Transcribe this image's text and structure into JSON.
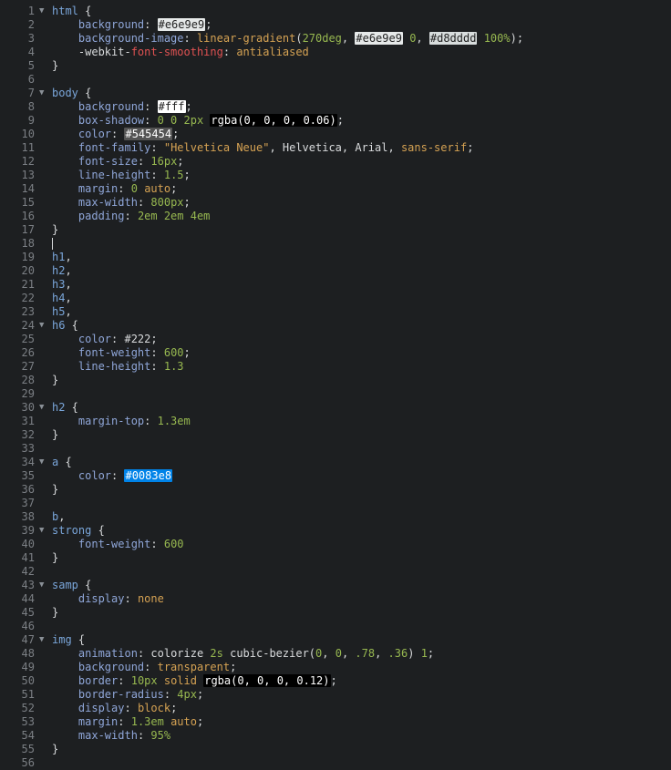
{
  "lines": [
    {
      "n": "1",
      "fold": true,
      "tokens": [
        {
          "t": "html",
          "c": "sel"
        },
        {
          "t": " {",
          "c": "p"
        }
      ]
    },
    {
      "n": "2",
      "fold": false,
      "tokens": [
        {
          "t": "    "
        },
        {
          "t": "background",
          "c": "prop"
        },
        {
          "t": ": ",
          "c": "p"
        },
        {
          "t": "#e6e9e9",
          "c": "hl",
          "bg": "#e6e9e9",
          "fg": "#222222"
        },
        {
          "t": ";",
          "c": "p"
        }
      ]
    },
    {
      "n": "3",
      "fold": false,
      "tokens": [
        {
          "t": "    "
        },
        {
          "t": "background-image",
          "c": "prop"
        },
        {
          "t": ": ",
          "c": "p"
        },
        {
          "t": "linear-gradient",
          "c": "kw"
        },
        {
          "t": "(",
          "c": "p"
        },
        {
          "t": "270deg",
          "c": "num"
        },
        {
          "t": ", ",
          "c": "p"
        },
        {
          "t": "#e6e9e9",
          "c": "hl",
          "bg": "#e6e9e9",
          "fg": "#222222"
        },
        {
          "t": " ",
          "c": "p"
        },
        {
          "t": "0",
          "c": "num"
        },
        {
          "t": ", ",
          "c": "p"
        },
        {
          "t": "#d8dddd",
          "c": "hl",
          "bg": "#d8dddd",
          "fg": "#222222"
        },
        {
          "t": " ",
          "c": "p"
        },
        {
          "t": "100%",
          "c": "num"
        },
        {
          "t": ");",
          "c": "p"
        }
      ]
    },
    {
      "n": "4",
      "fold": false,
      "tokens": [
        {
          "t": "    "
        },
        {
          "t": "-webkit-",
          "c": "p"
        },
        {
          "t": "font-smoothing",
          "c": "vendor"
        },
        {
          "t": ": ",
          "c": "p"
        },
        {
          "t": "antialiased",
          "c": "kw"
        }
      ]
    },
    {
      "n": "5",
      "fold": false,
      "tokens": [
        {
          "t": "}",
          "c": "p"
        }
      ]
    },
    {
      "n": "6",
      "fold": false,
      "tokens": []
    },
    {
      "n": "7",
      "fold": true,
      "tokens": [
        {
          "t": "body",
          "c": "sel"
        },
        {
          "t": " {",
          "c": "p"
        }
      ]
    },
    {
      "n": "8",
      "fold": false,
      "tokens": [
        {
          "t": "    "
        },
        {
          "t": "background",
          "c": "prop"
        },
        {
          "t": ": ",
          "c": "p"
        },
        {
          "t": "#fff",
          "c": "hl",
          "bg": "#ffffff",
          "fg": "#222222"
        },
        {
          "t": ";",
          "c": "p"
        }
      ]
    },
    {
      "n": "9",
      "fold": false,
      "tokens": [
        {
          "t": "    "
        },
        {
          "t": "box-shadow",
          "c": "prop"
        },
        {
          "t": ": ",
          "c": "p"
        },
        {
          "t": "0 0 2px",
          "c": "num"
        },
        {
          "t": " ",
          "c": "p"
        },
        {
          "t": "rgba(0, 0, 0, 0.06)",
          "c": "hl",
          "bg": "#000000",
          "fg": "#ffffff"
        },
        {
          "t": ";",
          "c": "p"
        }
      ]
    },
    {
      "n": "10",
      "fold": false,
      "tokens": [
        {
          "t": "    "
        },
        {
          "t": "color",
          "c": "prop"
        },
        {
          "t": ": ",
          "c": "p"
        },
        {
          "t": "#545454",
          "c": "hl",
          "bg": "#545454",
          "fg": "#ffffff"
        },
        {
          "t": ";",
          "c": "p"
        }
      ]
    },
    {
      "n": "11",
      "fold": false,
      "tokens": [
        {
          "t": "    "
        },
        {
          "t": "font-family",
          "c": "prop"
        },
        {
          "t": ": ",
          "c": "p"
        },
        {
          "t": "\"Helvetica Neue\"",
          "c": "str"
        },
        {
          "t": ", Helvetica, Arial, ",
          "c": "p"
        },
        {
          "t": "sans-serif",
          "c": "kw"
        },
        {
          "t": ";",
          "c": "p"
        }
      ]
    },
    {
      "n": "12",
      "fold": false,
      "tokens": [
        {
          "t": "    "
        },
        {
          "t": "font-size",
          "c": "prop"
        },
        {
          "t": ": ",
          "c": "p"
        },
        {
          "t": "16px",
          "c": "num"
        },
        {
          "t": ";",
          "c": "p"
        }
      ]
    },
    {
      "n": "13",
      "fold": false,
      "tokens": [
        {
          "t": "    "
        },
        {
          "t": "line-height",
          "c": "prop"
        },
        {
          "t": ": ",
          "c": "p"
        },
        {
          "t": "1.5",
          "c": "num"
        },
        {
          "t": ";",
          "c": "p"
        }
      ]
    },
    {
      "n": "14",
      "fold": false,
      "tokens": [
        {
          "t": "    "
        },
        {
          "t": "margin",
          "c": "prop"
        },
        {
          "t": ": ",
          "c": "p"
        },
        {
          "t": "0",
          "c": "num"
        },
        {
          "t": " ",
          "c": "p"
        },
        {
          "t": "auto",
          "c": "kw"
        },
        {
          "t": ";",
          "c": "p"
        }
      ]
    },
    {
      "n": "15",
      "fold": false,
      "tokens": [
        {
          "t": "    "
        },
        {
          "t": "max-width",
          "c": "prop"
        },
        {
          "t": ": ",
          "c": "p"
        },
        {
          "t": "800px",
          "c": "num"
        },
        {
          "t": ";",
          "c": "p"
        }
      ]
    },
    {
      "n": "16",
      "fold": false,
      "tokens": [
        {
          "t": "    "
        },
        {
          "t": "padding",
          "c": "prop"
        },
        {
          "t": ": ",
          "c": "p"
        },
        {
          "t": "2em 2em 4em",
          "c": "num"
        }
      ]
    },
    {
      "n": "17",
      "fold": false,
      "tokens": [
        {
          "t": "}",
          "c": "p"
        }
      ]
    },
    {
      "n": "18",
      "fold": false,
      "caret": true,
      "tokens": []
    },
    {
      "n": "19",
      "fold": false,
      "tokens": [
        {
          "t": "h1",
          "c": "sel"
        },
        {
          "t": ",",
          "c": "p"
        }
      ]
    },
    {
      "n": "20",
      "fold": false,
      "tokens": [
        {
          "t": "h2",
          "c": "sel"
        },
        {
          "t": ",",
          "c": "p"
        }
      ]
    },
    {
      "n": "21",
      "fold": false,
      "tokens": [
        {
          "t": "h3",
          "c": "sel"
        },
        {
          "t": ",",
          "c": "p"
        }
      ]
    },
    {
      "n": "22",
      "fold": false,
      "tokens": [
        {
          "t": "h4",
          "c": "sel"
        },
        {
          "t": ",",
          "c": "p"
        }
      ]
    },
    {
      "n": "23",
      "fold": false,
      "tokens": [
        {
          "t": "h5",
          "c": "sel"
        },
        {
          "t": ",",
          "c": "p"
        }
      ]
    },
    {
      "n": "24",
      "fold": true,
      "tokens": [
        {
          "t": "h6",
          "c": "sel"
        },
        {
          "t": " {",
          "c": "p"
        }
      ]
    },
    {
      "n": "25",
      "fold": false,
      "tokens": [
        {
          "t": "    "
        },
        {
          "t": "color",
          "c": "prop"
        },
        {
          "t": ": ",
          "c": "p"
        },
        {
          "t": "#222",
          "c": "p"
        },
        {
          "t": ";",
          "c": "p"
        }
      ]
    },
    {
      "n": "26",
      "fold": false,
      "tokens": [
        {
          "t": "    "
        },
        {
          "t": "font-weight",
          "c": "prop"
        },
        {
          "t": ": ",
          "c": "p"
        },
        {
          "t": "600",
          "c": "num"
        },
        {
          "t": ";",
          "c": "p"
        }
      ]
    },
    {
      "n": "27",
      "fold": false,
      "tokens": [
        {
          "t": "    "
        },
        {
          "t": "line-height",
          "c": "prop"
        },
        {
          "t": ": ",
          "c": "p"
        },
        {
          "t": "1.3",
          "c": "num"
        }
      ]
    },
    {
      "n": "28",
      "fold": false,
      "tokens": [
        {
          "t": "}",
          "c": "p"
        }
      ]
    },
    {
      "n": "29",
      "fold": false,
      "tokens": []
    },
    {
      "n": "30",
      "fold": true,
      "tokens": [
        {
          "t": "h2",
          "c": "sel"
        },
        {
          "t": " {",
          "c": "p"
        }
      ]
    },
    {
      "n": "31",
      "fold": false,
      "tokens": [
        {
          "t": "    "
        },
        {
          "t": "margin-top",
          "c": "prop"
        },
        {
          "t": ": ",
          "c": "p"
        },
        {
          "t": "1.3em",
          "c": "num"
        }
      ]
    },
    {
      "n": "32",
      "fold": false,
      "tokens": [
        {
          "t": "}",
          "c": "p"
        }
      ]
    },
    {
      "n": "33",
      "fold": false,
      "tokens": []
    },
    {
      "n": "34",
      "fold": true,
      "tokens": [
        {
          "t": "a",
          "c": "sel"
        },
        {
          "t": " {",
          "c": "p"
        }
      ]
    },
    {
      "n": "35",
      "fold": false,
      "tokens": [
        {
          "t": "    "
        },
        {
          "t": "color",
          "c": "prop"
        },
        {
          "t": ": ",
          "c": "p"
        },
        {
          "t": "#0083e8",
          "c": "hl",
          "bg": "#0083e8",
          "fg": "#ffffff"
        }
      ]
    },
    {
      "n": "36",
      "fold": false,
      "tokens": [
        {
          "t": "}",
          "c": "p"
        }
      ]
    },
    {
      "n": "37",
      "fold": false,
      "tokens": []
    },
    {
      "n": "38",
      "fold": false,
      "tokens": [
        {
          "t": "b",
          "c": "sel"
        },
        {
          "t": ",",
          "c": "p"
        }
      ]
    },
    {
      "n": "39",
      "fold": true,
      "tokens": [
        {
          "t": "strong",
          "c": "sel"
        },
        {
          "t": " {",
          "c": "p"
        }
      ]
    },
    {
      "n": "40",
      "fold": false,
      "tokens": [
        {
          "t": "    "
        },
        {
          "t": "font-weight",
          "c": "prop"
        },
        {
          "t": ": ",
          "c": "p"
        },
        {
          "t": "600",
          "c": "num"
        }
      ]
    },
    {
      "n": "41",
      "fold": false,
      "tokens": [
        {
          "t": "}",
          "c": "p"
        }
      ]
    },
    {
      "n": "42",
      "fold": false,
      "tokens": []
    },
    {
      "n": "43",
      "fold": true,
      "tokens": [
        {
          "t": "samp",
          "c": "sel"
        },
        {
          "t": " {",
          "c": "p"
        }
      ]
    },
    {
      "n": "44",
      "fold": false,
      "tokens": [
        {
          "t": "    "
        },
        {
          "t": "display",
          "c": "prop"
        },
        {
          "t": ": ",
          "c": "p"
        },
        {
          "t": "none",
          "c": "kw"
        }
      ]
    },
    {
      "n": "45",
      "fold": false,
      "tokens": [
        {
          "t": "}",
          "c": "p"
        }
      ]
    },
    {
      "n": "46",
      "fold": false,
      "tokens": []
    },
    {
      "n": "47",
      "fold": true,
      "tokens": [
        {
          "t": "img",
          "c": "sel"
        },
        {
          "t": " {",
          "c": "p"
        }
      ]
    },
    {
      "n": "48",
      "fold": false,
      "tokens": [
        {
          "t": "    "
        },
        {
          "t": "animation",
          "c": "prop"
        },
        {
          "t": ": ",
          "c": "p"
        },
        {
          "t": "colorize ",
          "c": "p"
        },
        {
          "t": "2s",
          "c": "num"
        },
        {
          "t": " cubic-bezier(",
          "c": "p"
        },
        {
          "t": "0",
          "c": "num"
        },
        {
          "t": ", ",
          "c": "p"
        },
        {
          "t": "0",
          "c": "num"
        },
        {
          "t": ", ",
          "c": "p"
        },
        {
          "t": ".78",
          "c": "num"
        },
        {
          "t": ", ",
          "c": "p"
        },
        {
          "t": ".36",
          "c": "num"
        },
        {
          "t": ") ",
          "c": "p"
        },
        {
          "t": "1",
          "c": "num"
        },
        {
          "t": ";",
          "c": "p"
        }
      ]
    },
    {
      "n": "49",
      "fold": false,
      "tokens": [
        {
          "t": "    "
        },
        {
          "t": "background",
          "c": "prop"
        },
        {
          "t": ": ",
          "c": "p"
        },
        {
          "t": "transparent",
          "c": "kw"
        },
        {
          "t": ";",
          "c": "p"
        }
      ]
    },
    {
      "n": "50",
      "fold": false,
      "tokens": [
        {
          "t": "    "
        },
        {
          "t": "border",
          "c": "prop"
        },
        {
          "t": ": ",
          "c": "p"
        },
        {
          "t": "10px",
          "c": "num"
        },
        {
          "t": " ",
          "c": "p"
        },
        {
          "t": "solid",
          "c": "kw"
        },
        {
          "t": " ",
          "c": "p"
        },
        {
          "t": "rgba(0, 0, 0, 0.12)",
          "c": "hl",
          "bg": "#000000",
          "fg": "#ffffff"
        },
        {
          "t": ";",
          "c": "p"
        }
      ]
    },
    {
      "n": "51",
      "fold": false,
      "tokens": [
        {
          "t": "    "
        },
        {
          "t": "border-radius",
          "c": "prop"
        },
        {
          "t": ": ",
          "c": "p"
        },
        {
          "t": "4px",
          "c": "num"
        },
        {
          "t": ";",
          "c": "p"
        }
      ]
    },
    {
      "n": "52",
      "fold": false,
      "tokens": [
        {
          "t": "    "
        },
        {
          "t": "display",
          "c": "prop"
        },
        {
          "t": ": ",
          "c": "p"
        },
        {
          "t": "block",
          "c": "kw"
        },
        {
          "t": ";",
          "c": "p"
        }
      ]
    },
    {
      "n": "53",
      "fold": false,
      "tokens": [
        {
          "t": "    "
        },
        {
          "t": "margin",
          "c": "prop"
        },
        {
          "t": ": ",
          "c": "p"
        },
        {
          "t": "1.3em",
          "c": "num"
        },
        {
          "t": " ",
          "c": "p"
        },
        {
          "t": "auto",
          "c": "kw"
        },
        {
          "t": ";",
          "c": "p"
        }
      ]
    },
    {
      "n": "54",
      "fold": false,
      "tokens": [
        {
          "t": "    "
        },
        {
          "t": "max-width",
          "c": "prop"
        },
        {
          "t": ": ",
          "c": "p"
        },
        {
          "t": "95%",
          "c": "num"
        }
      ]
    },
    {
      "n": "55",
      "fold": false,
      "tokens": [
        {
          "t": "}",
          "c": "p"
        }
      ]
    },
    {
      "n": "56",
      "fold": false,
      "tokens": []
    }
  ]
}
